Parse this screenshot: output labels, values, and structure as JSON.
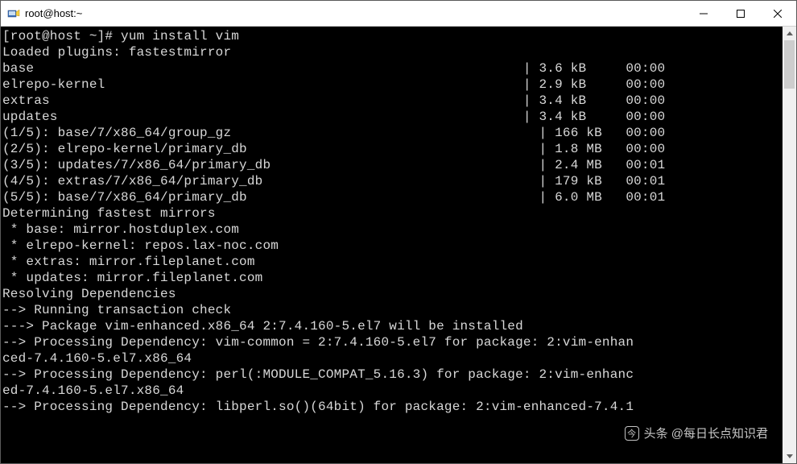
{
  "titlebar": {
    "title": "root@host:~"
  },
  "terminal": {
    "prompt": "[root@host ~]# ",
    "command": "yum install vim",
    "lines": [
      "Loaded plugins: fastestmirror",
      "base                                                              | 3.6 kB     00:00",
      "elrepo-kernel                                                     | 2.9 kB     00:00",
      "extras                                                            | 3.4 kB     00:00",
      "updates                                                           | 3.4 kB     00:00",
      "(1/5): base/7/x86_64/group_gz                                       | 166 kB   00:00",
      "(2/5): elrepo-kernel/primary_db                                     | 1.8 MB   00:00",
      "(3/5): updates/7/x86_64/primary_db                                  | 2.4 MB   00:01",
      "(4/5): extras/7/x86_64/primary_db                                   | 179 kB   00:01",
      "(5/5): base/7/x86_64/primary_db                                     | 6.0 MB   00:01",
      "Determining fastest mirrors",
      " * base: mirror.hostduplex.com",
      " * elrepo-kernel: repos.lax-noc.com",
      " * extras: mirror.fileplanet.com",
      " * updates: mirror.fileplanet.com",
      "Resolving Dependencies",
      "--> Running transaction check",
      "---> Package vim-enhanced.x86_64 2:7.4.160-5.el7 will be installed",
      "--> Processing Dependency: vim-common = 2:7.4.160-5.el7 for package: 2:vim-enhan",
      "ced-7.4.160-5.el7.x86_64",
      "--> Processing Dependency: perl(:MODULE_COMPAT_5.16.3) for package: 2:vim-enhanc",
      "ed-7.4.160-5.el7.x86_64",
      "--> Processing Dependency: libperl.so()(64bit) for package: 2:vim-enhanced-7.4.1"
    ]
  },
  "watermark": {
    "text": "头条 @每日长点知识君",
    "icon_glyph": "今"
  }
}
